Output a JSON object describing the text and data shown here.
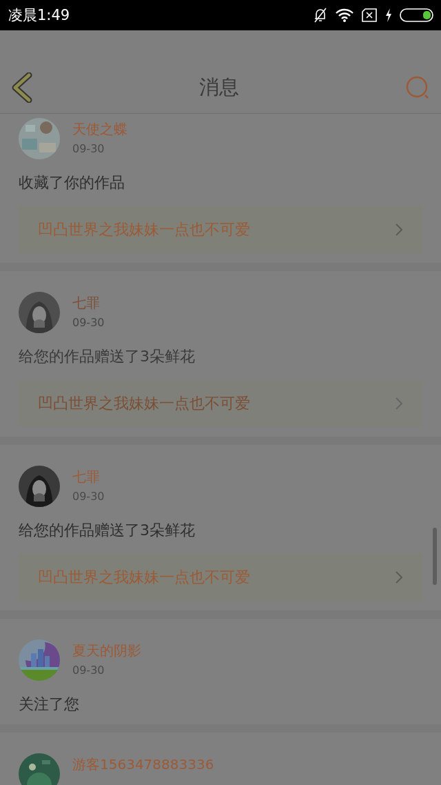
{
  "status_bar": {
    "time": "凌晨1:49"
  },
  "header": {
    "title": "消息"
  },
  "messages": [
    {
      "name": "天使之蝶",
      "time": "09-30",
      "text": "收藏了你的作品",
      "work": "凹凸世界之我妹妹一点也不可爱",
      "faded": false
    },
    {
      "name": "七罪",
      "time": "09-30",
      "text": "给您的作品赠送了3朵鲜花",
      "work": "凹凸世界之我妹妹一点也不可爱",
      "faded": true
    },
    {
      "name": "七罪",
      "time": "09-30",
      "text": "给您的作品赠送了3朵鲜花",
      "work": "凹凸世界之我妹妹一点也不可爱",
      "faded": false
    },
    {
      "name": "夏天的阴影",
      "time": "09-30",
      "text": "关注了您",
      "faded": false
    },
    {
      "name": "游客1563478883336",
      "faded": false
    }
  ]
}
